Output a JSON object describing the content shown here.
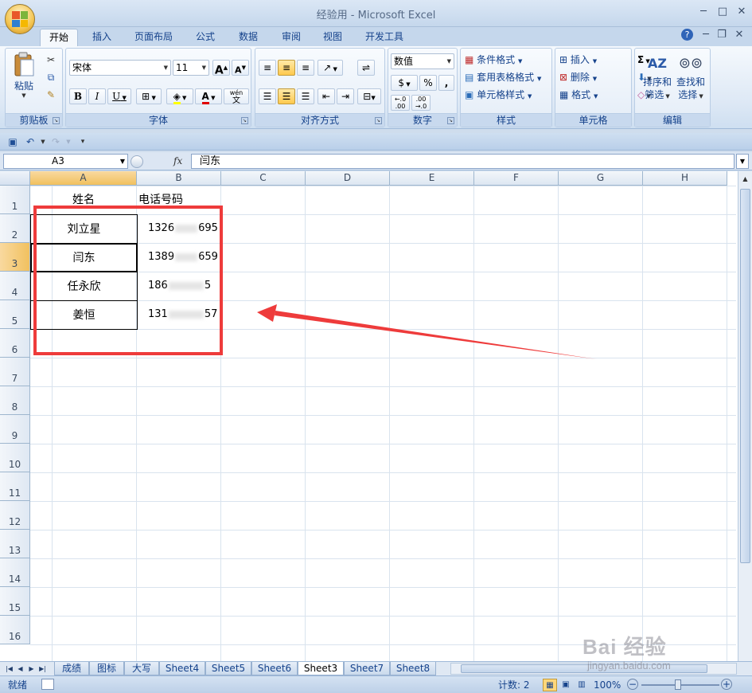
{
  "window": {
    "title": "经验用 - Microsoft Excel",
    "controls": {
      "minimize": "─",
      "maximize": "□",
      "close": "✕"
    }
  },
  "ribbon_tabs": [
    "开始",
    "插入",
    "页面布局",
    "公式",
    "数据",
    "审阅",
    "视图",
    "开发工具"
  ],
  "ribbon_right_icons": {
    "help": "?",
    "minimize": "─",
    "restore": "❐",
    "close": "✕"
  },
  "clipboard": {
    "paste": "粘贴",
    "label": "剪贴板"
  },
  "font": {
    "name": "宋体",
    "size": "11",
    "grow": "A",
    "shrink": "A",
    "bold": "B",
    "italic": "I",
    "underline": "U",
    "wen": "wén",
    "wen_char": "文",
    "label": "字体"
  },
  "alignment": {
    "label": "对齐方式"
  },
  "number": {
    "format": "数值",
    "percent": "%",
    "comma": ",",
    "inc": "+.0\n.00",
    "dec": ".00\n→.0",
    "label": "数字"
  },
  "styles": {
    "conditional": "条件格式",
    "table": "套用表格格式",
    "cell": "单元格样式",
    "label": "样式"
  },
  "cells": {
    "insert": "插入",
    "delete": "删除",
    "format": "格式",
    "label": "单元格"
  },
  "editing": {
    "sum": "Σ",
    "sort": "排序和",
    "sort2": "筛选",
    "find": "查找和",
    "find2": "选择",
    "label": "编辑"
  },
  "formula_bar": {
    "name_box": "A3",
    "fx": "fx",
    "content": "闫东"
  },
  "columns": [
    "A",
    "B",
    "C",
    "D",
    "E",
    "F",
    "G",
    "H"
  ],
  "rows": [
    "1",
    "2",
    "3",
    "4",
    "5",
    "6",
    "7",
    "8",
    "9",
    "10",
    "11",
    "12",
    "13",
    "14",
    "15",
    "16"
  ],
  "table": {
    "headers": {
      "name": "姓名",
      "phone": "电话号码"
    },
    "records": [
      {
        "name": "刘立星",
        "phone_start": "1326",
        "phone_end": "695"
      },
      {
        "name": "闫东",
        "phone_start": "1389",
        "phone_end": "659"
      },
      {
        "name": "任永欣",
        "phone_start": "186",
        "phone_end": "5"
      },
      {
        "name": "姜恒",
        "phone_start": "131",
        "phone_end": "57"
      }
    ]
  },
  "sheet_tabs": [
    "成绩",
    "图标",
    "大写",
    "Sheet4",
    "Sheet5",
    "Sheet6",
    "Sheet3",
    "Sheet7",
    "Sheet8"
  ],
  "active_sheet": "Sheet3",
  "status": {
    "ready": "就绪",
    "count": "计数: 2",
    "zoom": "100%"
  },
  "watermark": {
    "brand": "Bai 经验",
    "url": "jingyan.baidu.com"
  },
  "colors": {
    "annotation": "#ee3b3b",
    "ribbon_text": "#15428b"
  }
}
